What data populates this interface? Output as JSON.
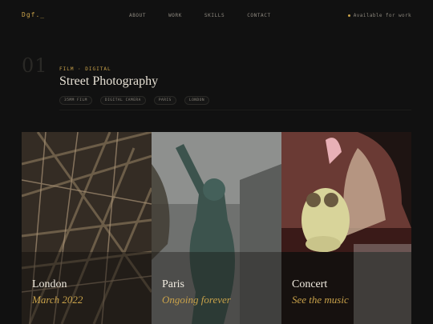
{
  "nav": {
    "logo": "Dgf._",
    "links": [
      "ABOUT",
      "WORK",
      "SKILLS",
      "CONTACT"
    ],
    "availability": "Available for work"
  },
  "section": {
    "number": "01",
    "kicker": "FILM · DIGITAL",
    "title": "Street Photography",
    "tags": [
      "35MM FILM",
      "DIGITAL CAMERA",
      "PARIS",
      "LONDON"
    ]
  },
  "gallery": [
    {
      "title": "London",
      "subtitle": "March 2022",
      "image": "steel-structure-photo"
    },
    {
      "title": "Paris",
      "subtitle": "Ongoing forever",
      "image": "statue-photo"
    },
    {
      "title": "Concert",
      "subtitle": "See the music",
      "image": "concert-photo"
    }
  ],
  "colors": {
    "background": "#111111",
    "accent": "#c9a24a",
    "text": "#e6e0d4",
    "muted": "#8a857b"
  }
}
